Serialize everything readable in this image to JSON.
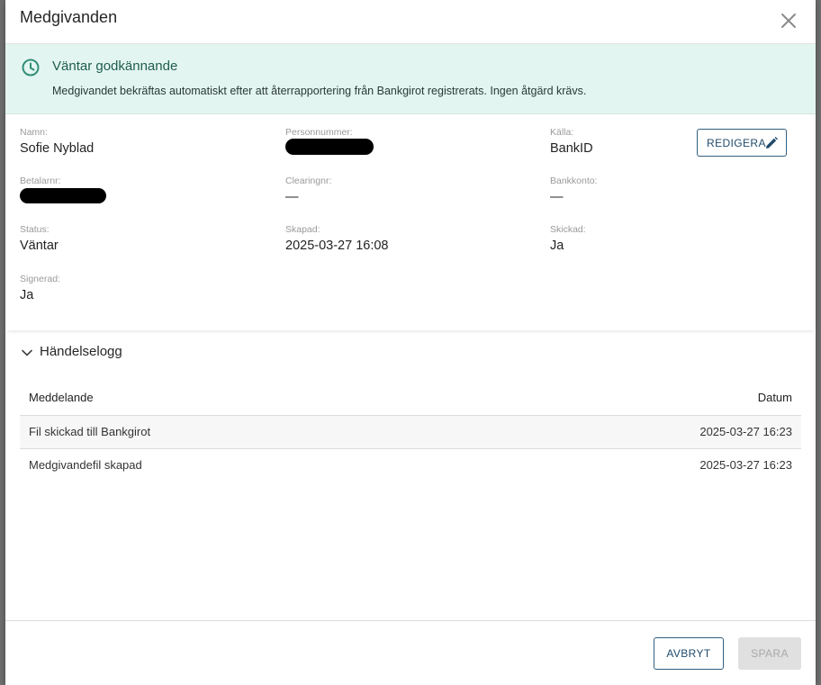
{
  "modal": {
    "title": "Medgivanden",
    "close_icon": "close-icon"
  },
  "alert": {
    "icon": "clock-icon",
    "title": "Väntar godkännande",
    "text": "Medgivandet bekräftas automatiskt efter att återrapportering från Bankgirot registrerats. Ingen åtgärd krävs.",
    "color": "#e3f5f0",
    "accent": "#2f8f76"
  },
  "details": {
    "name_label": "Namn:",
    "name_value": "Sofie Nyblad",
    "personnummer_label": "Personnummer:",
    "source_label": "Källa:",
    "source_value": "BankID",
    "edit_label": "REDIGERA",
    "payer_label": "Betalarnr:",
    "clearing_label": "Clearingnr:",
    "clearing_value": "—",
    "account_label": "Bankkonto:",
    "account_value": "—",
    "status_label": "Status:",
    "status_value": "Väntar",
    "created_label": "Skapad:",
    "created_value": "2025-03-27 16:08",
    "sent_label": "Skickad:",
    "sent_value": "Ja",
    "signed_label": "Signerad:",
    "signed_value": "Ja"
  },
  "log": {
    "title": "Händelselogg",
    "col_message": "Meddelande",
    "col_date": "Datum",
    "rows": [
      {
        "message": "Fil skickad till Bankgirot",
        "date": "2025-03-27 16:23"
      },
      {
        "message": "Medgivandefil skapad",
        "date": "2025-03-27 16:23"
      }
    ]
  },
  "footer": {
    "cancel_label": "AVBRYT",
    "save_label": "SPARA"
  }
}
